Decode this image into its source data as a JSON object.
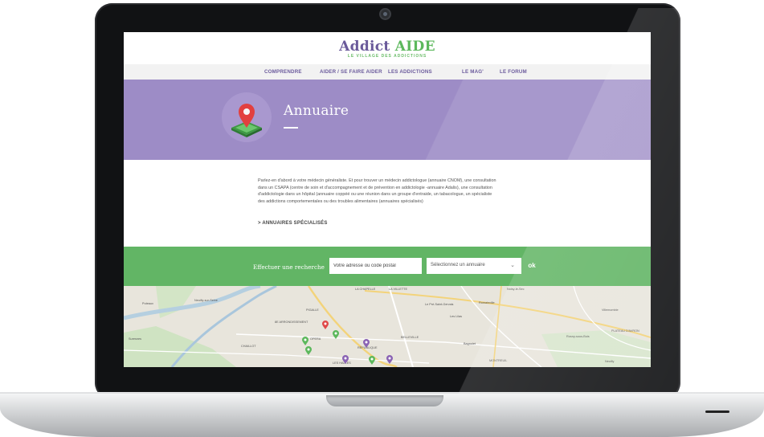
{
  "site": {
    "logo_part1": "Addict",
    "logo_part2": "AIDE",
    "tagline": "LE VILLAGE DES ADDICTIONS"
  },
  "nav": {
    "items": [
      {
        "label": "COMPRENDRE"
      },
      {
        "label": "AIDER / SE FAIRE AIDER"
      },
      {
        "label": "LES ADDICTIONS"
      },
      {
        "label": "LE MAG'"
      },
      {
        "label": "LE FORUM"
      }
    ]
  },
  "banner": {
    "title": "Annuaire",
    "icon": "map-pin-icon"
  },
  "intro": {
    "text": "Parlez-en d'abord à votre médecin généraliste. Et pour trouver un médecin addictologue (annuaire CNOM), une consultation dans un CSAPA (centre de soin et d'accompagnement et de prévention en addictologie -annuaire Adalis), une consultation d'addictologie dans un hôpital (annuaire coppéé ou une réunion dans un groupe d'entraide, un tabacologue, un spécialiste des addictions comportementales ou des troubles alimentaires (annuaires spécialisés)",
    "link_label": "> ANNUAIRES SPÉCIALISÉS"
  },
  "search": {
    "label": "Effectuer une recherche",
    "address_placeholder": "Votre adresse ou code postal",
    "select_value": "Sélectionnez un annuaire",
    "submit_label": "ok"
  },
  "map": {
    "places": [
      {
        "name": "Puteaux"
      },
      {
        "name": "Neuilly-sur-Seine"
      },
      {
        "name": "Suresnes"
      },
      {
        "name": "CHAILLOT"
      },
      {
        "name": "8E ARRONDISSEMENT"
      },
      {
        "name": "PIGALLE"
      },
      {
        "name": "OPERA"
      },
      {
        "name": "LA CHAPELLE"
      },
      {
        "name": "LA VILLETTE"
      },
      {
        "name": "RÉPUBLIQUE"
      },
      {
        "name": "BELLEVILLE"
      },
      {
        "name": "LES HALLES"
      },
      {
        "name": "Le Pré-Saint-Gervais"
      },
      {
        "name": "Les Lilas"
      },
      {
        "name": "Romainville"
      },
      {
        "name": "Noisy-le-Sec"
      },
      {
        "name": "Bagnolet"
      },
      {
        "name": "MONTREUIL"
      },
      {
        "name": "Villemomble"
      },
      {
        "name": "Rosny-sous-Bois"
      },
      {
        "name": "PLATEAU D'AVRON"
      },
      {
        "name": "Neuilly"
      }
    ],
    "colors": {
      "green": "#5cb85c",
      "purple": "#8a63b4",
      "red": "#e04848"
    }
  },
  "colors": {
    "brand_purple": "#9d8cc6",
    "brand_green": "#62b565",
    "nav_text": "#6b5b9c"
  }
}
